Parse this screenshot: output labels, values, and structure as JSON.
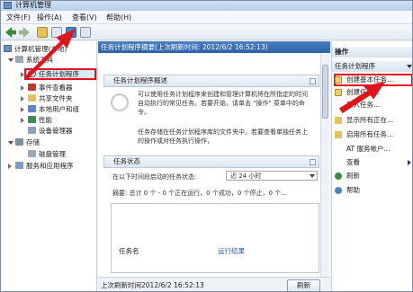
{
  "window": {
    "title": "计算机管理"
  },
  "menu": [
    {
      "label": "文件(F)"
    },
    {
      "label": "操作(A)"
    },
    {
      "label": "查看(V)"
    },
    {
      "label": "帮助(H)"
    }
  ],
  "tree": {
    "root": "计算机管理(本地)",
    "system_tools": "系统工具",
    "selected": "任务计划程序",
    "event_viewer": "事件查看器",
    "shared_folders": "共享文件夹",
    "local_users": "本地用户和组",
    "performance": "性能",
    "device_manager": "设备管理器",
    "storage": "存储",
    "disk_management": "磁盘管理",
    "services_apps": "服务和应用程序"
  },
  "middle": {
    "header": "任务计划程序摘要(上次刷新时间: 2012/6/2 16:52:13)",
    "overview_title": "任务计划程序概述",
    "overview_text1": "可以使用任务计划程序来创建和管理计算机将在所指定的时间自动执行的常见任务。若要开始，请单击 \"操作\" 菜单中的命令。",
    "overview_text2": "任务存储在任务计划程序库的文件夹中。若要查看单独任务上的操作或对任务执行操作，",
    "status_title": "任务状态",
    "status_label": "在以下时间段启动的任务状态:",
    "status_value": "近 24 小时",
    "summary": "摘要: 总计 0 个 - 0 个正在运行，0 个成功，0 个停止，0 个...",
    "col_task_name": "任务名",
    "col_run_result": "运行结果",
    "footer_text": "上次刷新时间2012/6/2 16:52:13",
    "refresh_button": "刷新"
  },
  "actions": {
    "header": "操作",
    "section": "任务计划程序",
    "items": [
      {
        "label": "创建基本任务..."
      },
      {
        "label": "创建任务..."
      },
      {
        "label": "导入任务..."
      },
      {
        "label": "显示所有正在..."
      },
      {
        "label": "启用所有任务..."
      },
      {
        "label": "AT 服务帐户..."
      },
      {
        "label": "查看"
      },
      {
        "label": "刷新"
      },
      {
        "label": "帮助"
      }
    ]
  },
  "colors": {
    "highlight": "#e0141c",
    "header_blue": "#2f62a8",
    "selection": "#dbe8f8"
  }
}
